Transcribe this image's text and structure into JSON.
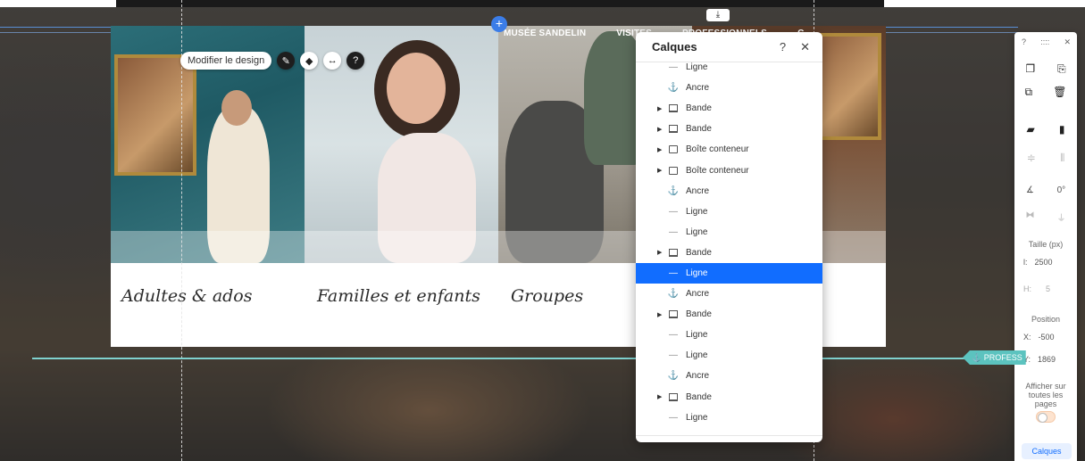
{
  "page_nav": {
    "items": [
      "MUSÉE SANDELIN",
      "VISITES",
      "PROFESSIONNELS",
      "C"
    ]
  },
  "captions": [
    "Adultes & ados",
    "Familles et enfants",
    "Groupes"
  ],
  "editor": {
    "edit_design_label": "Modifier le design",
    "download_label": "⤓",
    "add_label": "+"
  },
  "layers_panel": {
    "title": "Calques",
    "help": "?",
    "close": "✕",
    "items": [
      {
        "type": "line",
        "label": "Ligne"
      },
      {
        "type": "anchor",
        "label": "Ancre"
      },
      {
        "type": "strip",
        "label": "Bande",
        "expandable": true
      },
      {
        "type": "strip",
        "label": "Bande",
        "expandable": true
      },
      {
        "type": "box",
        "label": "Boîte conteneur",
        "expandable": true
      },
      {
        "type": "box",
        "label": "Boîte conteneur",
        "expandable": true
      },
      {
        "type": "anchor",
        "label": "Ancre"
      },
      {
        "type": "line",
        "label": "Ligne"
      },
      {
        "type": "line",
        "label": "Ligne"
      },
      {
        "type": "strip",
        "label": "Bande",
        "expandable": true
      },
      {
        "type": "line",
        "label": "Ligne",
        "selected": true
      },
      {
        "type": "anchor",
        "label": "Ancre"
      },
      {
        "type": "strip",
        "label": "Bande",
        "expandable": true
      },
      {
        "type": "line",
        "label": "Ligne"
      },
      {
        "type": "line",
        "label": "Ligne"
      },
      {
        "type": "anchor",
        "label": "Ancre"
      },
      {
        "type": "strip",
        "label": "Bande",
        "expandable": true
      },
      {
        "type": "line",
        "label": "Ligne"
      }
    ]
  },
  "properties": {
    "top_help": "?",
    "top_grip": "::::",
    "top_close": "✕",
    "rotation": "0°",
    "size_label": "Taille (px)",
    "width_key": "l:",
    "width_value": "2500",
    "height_key": "H:",
    "height_value": "5",
    "position_label": "Position",
    "x_key": "X:",
    "x_value": "-500",
    "y_key": "Y:",
    "y_value": "1869",
    "show_all_pages_label": "Afficher sur toutes les pages",
    "layers_button": "Calques"
  },
  "anchor_tag": "⚓ PROFESS",
  "colors": {
    "selection": "#116dff",
    "guide_teal": "#7fd2cf",
    "add_button": "#3b7de8"
  }
}
